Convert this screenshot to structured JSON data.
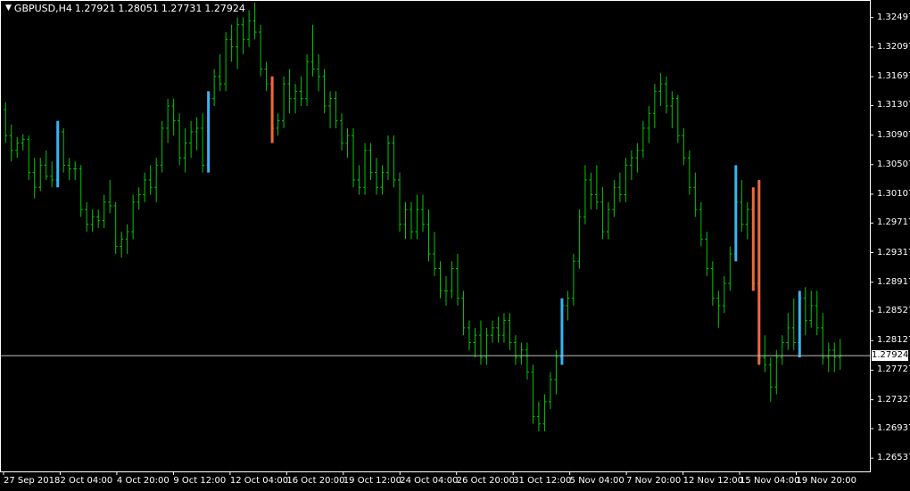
{
  "header": {
    "symbol": "GBPUSD,H4",
    "open": "1.27921",
    "high": "1.28051",
    "low": "1.27731",
    "close": "1.27924"
  },
  "last_price": "1.27924",
  "colors": {
    "background": "#000000",
    "up_candle": "#00c800",
    "down_candle": "#00c800",
    "highlight_up": "#3ab4f0",
    "highlight_down": "#f06a3a",
    "grid_line": "#c0c0c0",
    "text": "#ffffff"
  },
  "chart_data": {
    "type": "bar",
    "title": "",
    "xlabel": "",
    "ylabel": "",
    "ylim": [
      1.2637,
      1.3271
    ],
    "grid": false,
    "y_ticks": [
      "1.32497",
      "1.32097",
      "1.31697",
      "1.31307",
      "1.30907",
      "1.30507",
      "1.30107",
      "1.29717",
      "1.29317",
      "1.28917",
      "1.28527",
      "1.28127",
      "1.27727",
      "1.27327",
      "1.26937",
      "1.26537"
    ],
    "x_ticks": [
      "27 Sep 2018",
      "2 Oct 04:00",
      "4 Oct 20:00",
      "9 Oct 12:00",
      "12 Oct 04:00",
      "16 Oct 20:00",
      "19 Oct 12:00",
      "24 Oct 04:00",
      "26 Oct 20:00",
      "31 Oct 12:00",
      "5 Nov 04:00",
      "7 Nov 20:00",
      "12 Nov 12:00",
      "15 Nov 04:00",
      "19 Nov 20:00"
    ],
    "current_price_line": 1.27924,
    "ohlc": [
      [
        1.3125,
        1.3135,
        1.308,
        1.309
      ],
      [
        1.309,
        1.3105,
        1.3055,
        1.307
      ],
      [
        1.307,
        1.3088,
        1.306,
        1.308
      ],
      [
        1.308,
        1.3092,
        1.307,
        1.3085
      ],
      [
        1.3085,
        1.309,
        1.303,
        1.304
      ],
      [
        1.304,
        1.306,
        1.3005,
        1.302
      ],
      [
        1.302,
        1.306,
        1.3015,
        1.305
      ],
      [
        1.305,
        1.307,
        1.303,
        1.3035
      ],
      [
        1.3035,
        1.3055,
        1.302,
        1.303
      ],
      [
        1.303,
        1.311,
        1.302,
        1.3095
      ],
      [
        1.3095,
        1.31,
        1.304,
        1.305
      ],
      [
        1.305,
        1.306,
        1.303,
        1.3045
      ],
      [
        1.3045,
        1.3055,
        1.303,
        1.3045
      ],
      [
        1.3045,
        1.305,
        1.298,
        1.299
      ],
      [
        1.299,
        1.3,
        1.296,
        1.297
      ],
      [
        1.297,
        1.299,
        1.296,
        1.298
      ],
      [
        1.298,
        1.299,
        1.2965,
        1.2975
      ],
      [
        1.2975,
        1.301,
        1.2965,
        1.3
      ],
      [
        1.3,
        1.303,
        1.2985,
        1.2995
      ],
      [
        1.2995,
        1.3,
        1.293,
        1.294
      ],
      [
        1.294,
        1.296,
        1.2925,
        1.295
      ],
      [
        1.295,
        1.297,
        1.293,
        1.296
      ],
      [
        1.296,
        1.301,
        1.295,
        1.3
      ],
      [
        1.3,
        1.302,
        1.299,
        1.301
      ],
      [
        1.301,
        1.304,
        1.3,
        1.303
      ],
      [
        1.303,
        1.305,
        1.301,
        1.302
      ],
      [
        1.302,
        1.306,
        1.3,
        1.305
      ],
      [
        1.305,
        1.311,
        1.304,
        1.31
      ],
      [
        1.31,
        1.314,
        1.308,
        1.313
      ],
      [
        1.313,
        1.314,
        1.309,
        1.311
      ],
      [
        1.311,
        1.312,
        1.305,
        1.306
      ],
      [
        1.306,
        1.31,
        1.304,
        1.308
      ],
      [
        1.308,
        1.311,
        1.306,
        1.3095
      ],
      [
        1.3095,
        1.3115,
        1.307,
        1.31
      ],
      [
        1.31,
        1.312,
        1.304,
        1.305
      ],
      [
        1.305,
        1.315,
        1.304,
        1.314
      ],
      [
        1.314,
        1.318,
        1.313,
        1.317
      ],
      [
        1.317,
        1.32,
        1.315,
        1.316
      ],
      [
        1.316,
        1.323,
        1.315,
        1.322
      ],
      [
        1.322,
        1.324,
        1.319,
        1.321
      ],
      [
        1.321,
        1.325,
        1.318,
        1.324
      ],
      [
        1.324,
        1.325,
        1.32,
        1.322
      ],
      [
        1.322,
        1.326,
        1.321,
        1.3245
      ],
      [
        1.3245,
        1.327,
        1.322,
        1.323
      ],
      [
        1.323,
        1.324,
        1.317,
        1.318
      ],
      [
        1.318,
        1.319,
        1.315,
        1.316
      ],
      [
        1.316,
        1.317,
        1.308,
        1.31
      ],
      [
        1.31,
        1.312,
        1.309,
        1.311
      ],
      [
        1.311,
        1.317,
        1.31,
        1.316
      ],
      [
        1.316,
        1.318,
        1.312,
        1.314
      ],
      [
        1.314,
        1.316,
        1.312,
        1.315
      ],
      [
        1.315,
        1.317,
        1.313,
        1.314
      ],
      [
        1.314,
        1.32,
        1.313,
        1.319
      ],
      [
        1.319,
        1.324,
        1.317,
        1.318
      ],
      [
        1.318,
        1.32,
        1.315,
        1.317
      ],
      [
        1.317,
        1.318,
        1.312,
        1.313
      ],
      [
        1.313,
        1.315,
        1.31,
        1.314
      ],
      [
        1.314,
        1.315,
        1.31,
        1.311
      ],
      [
        1.311,
        1.312,
        1.307,
        1.308
      ],
      [
        1.308,
        1.31,
        1.306,
        1.309
      ],
      [
        1.309,
        1.31,
        1.302,
        1.303
      ],
      [
        1.303,
        1.305,
        1.301,
        1.302
      ],
      [
        1.302,
        1.308,
        1.301,
        1.307
      ],
      [
        1.307,
        1.308,
        1.303,
        1.304
      ],
      [
        1.304,
        1.306,
        1.301,
        1.302
      ],
      [
        1.302,
        1.305,
        1.301,
        1.304
      ],
      [
        1.304,
        1.309,
        1.303,
        1.308
      ],
      [
        1.308,
        1.309,
        1.302,
        1.303
      ],
      [
        1.303,
        1.304,
        1.296,
        1.297
      ],
      [
        1.297,
        1.3,
        1.295,
        1.299
      ],
      [
        1.299,
        1.3,
        1.295,
        1.296
      ],
      [
        1.296,
        1.301,
        1.295,
        1.299
      ],
      [
        1.299,
        1.301,
        1.296,
        1.297
      ],
      [
        1.297,
        1.299,
        1.292,
        1.293
      ],
      [
        1.293,
        1.296,
        1.29,
        1.291
      ],
      [
        1.291,
        1.292,
        1.287,
        1.288
      ],
      [
        1.288,
        1.29,
        1.286,
        1.288
      ],
      [
        1.288,
        1.292,
        1.287,
        1.291
      ],
      [
        1.291,
        1.293,
        1.286,
        1.287
      ],
      [
        1.287,
        1.288,
        1.282,
        1.283
      ],
      [
        1.283,
        1.284,
        1.28,
        1.281
      ],
      [
        1.281,
        1.283,
        1.279,
        1.282
      ],
      [
        1.282,
        1.284,
        1.278,
        1.279
      ],
      [
        1.279,
        1.283,
        1.278,
        1.282
      ],
      [
        1.282,
        1.284,
        1.281,
        1.283
      ],
      [
        1.283,
        1.2845,
        1.281,
        1.282
      ],
      [
        1.282,
        1.285,
        1.281,
        1.284
      ],
      [
        1.284,
        1.285,
        1.28,
        1.281
      ],
      [
        1.281,
        1.282,
        1.278,
        1.279
      ],
      [
        1.279,
        1.281,
        1.278,
        1.28
      ],
      [
        1.28,
        1.281,
        1.276,
        1.277
      ],
      [
        1.277,
        1.278,
        1.27,
        1.271
      ],
      [
        1.271,
        1.273,
        1.269,
        1.27
      ],
      [
        1.27,
        1.274,
        1.269,
        1.273
      ],
      [
        1.273,
        1.277,
        1.272,
        1.276
      ],
      [
        1.276,
        1.28,
        1.274,
        1.279
      ],
      [
        1.279,
        1.287,
        1.278,
        1.286
      ],
      [
        1.286,
        1.288,
        1.284,
        1.287
      ],
      [
        1.287,
        1.293,
        1.286,
        1.292
      ],
      [
        1.292,
        1.299,
        1.291,
        1.298
      ],
      [
        1.298,
        1.305,
        1.297,
        1.303
      ],
      [
        1.303,
        1.304,
        1.299,
        1.301
      ],
      [
        1.301,
        1.305,
        1.299,
        1.3
      ],
      [
        1.3,
        1.302,
        1.295,
        1.296
      ],
      [
        1.296,
        1.3,
        1.295,
        1.299
      ],
      [
        1.299,
        1.303,
        1.298,
        1.302
      ],
      [
        1.302,
        1.304,
        1.3,
        1.301
      ],
      [
        1.301,
        1.306,
        1.3,
        1.305
      ],
      [
        1.305,
        1.307,
        1.303,
        1.306
      ],
      [
        1.306,
        1.308,
        1.304,
        1.307
      ],
      [
        1.307,
        1.311,
        1.306,
        1.31
      ],
      [
        1.31,
        1.313,
        1.308,
        1.312
      ],
      [
        1.312,
        1.316,
        1.31,
        1.315
      ],
      [
        1.315,
        1.3175,
        1.313,
        1.316
      ],
      [
        1.316,
        1.317,
        1.312,
        1.313
      ],
      [
        1.313,
        1.315,
        1.31,
        1.314
      ],
      [
        1.314,
        1.3145,
        1.308,
        1.309
      ],
      [
        1.309,
        1.31,
        1.305,
        1.306
      ],
      [
        1.306,
        1.307,
        1.301,
        1.302
      ],
      [
        1.302,
        1.304,
        1.298,
        1.299
      ],
      [
        1.299,
        1.3,
        1.294,
        1.295
      ],
      [
        1.295,
        1.296,
        1.29,
        1.291
      ],
      [
        1.291,
        1.292,
        1.286,
        1.287
      ],
      [
        1.287,
        1.288,
        1.283,
        1.286
      ],
      [
        1.286,
        1.29,
        1.285,
        1.289
      ],
      [
        1.289,
        1.294,
        1.288,
        1.293
      ],
      [
        1.293,
        1.305,
        1.292,
        1.3
      ],
      [
        1.3,
        1.303,
        1.296,
        1.297
      ],
      [
        1.297,
        1.3,
        1.295,
        1.299
      ],
      [
        1.299,
        1.302,
        1.288,
        1.289
      ],
      [
        1.289,
        1.303,
        1.278,
        1.279
      ],
      [
        1.279,
        1.282,
        1.277,
        1.278
      ],
      [
        1.278,
        1.279,
        1.273,
        1.275
      ],
      [
        1.275,
        1.28,
        1.274,
        1.279
      ],
      [
        1.279,
        1.282,
        1.278,
        1.281
      ],
      [
        1.281,
        1.285,
        1.28,
        1.283
      ],
      [
        1.283,
        1.287,
        1.28,
        1.281
      ],
      [
        1.281,
        1.288,
        1.279,
        1.287
      ],
      [
        1.287,
        1.2885,
        1.282,
        1.284
      ],
      [
        1.284,
        1.288,
        1.283,
        1.286
      ],
      [
        1.286,
        1.288,
        1.282,
        1.283
      ],
      [
        1.283,
        1.285,
        1.278,
        1.279
      ],
      [
        1.279,
        1.281,
        1.277,
        1.28
      ],
      [
        1.28,
        1.281,
        1.277,
        1.279
      ],
      [
        1.279,
        1.2815,
        1.2773,
        1.2792
      ]
    ]
  }
}
